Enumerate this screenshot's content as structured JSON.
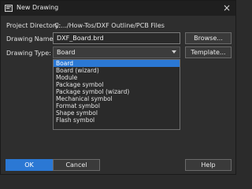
{
  "window": {
    "title": "New Drawing",
    "close_glyph": "×"
  },
  "project": {
    "label": "Project Directory:",
    "value": "C:.../How-Tos/DXF Outline/PCB Files"
  },
  "drawing_name": {
    "label": "Drawing Name:",
    "value": "DXF_Board.brd"
  },
  "drawing_type": {
    "label": "Drawing Type:",
    "selected": "Board"
  },
  "buttons": {
    "browse": "Browse...",
    "template": "Template...",
    "ok": "OK",
    "cancel": "Cancel",
    "help": "Help"
  },
  "type_list": [
    "Board",
    "Board (wizard)",
    "Module",
    "Package symbol",
    "Package symbol (wizard)",
    "Mechanical symbol",
    "Format symbol",
    "Shape symbol",
    "Flash symbol"
  ],
  "colors": {
    "accent": "#2b78d4",
    "background": "#2e2e2e",
    "titlebar": "#1f1f1f"
  }
}
